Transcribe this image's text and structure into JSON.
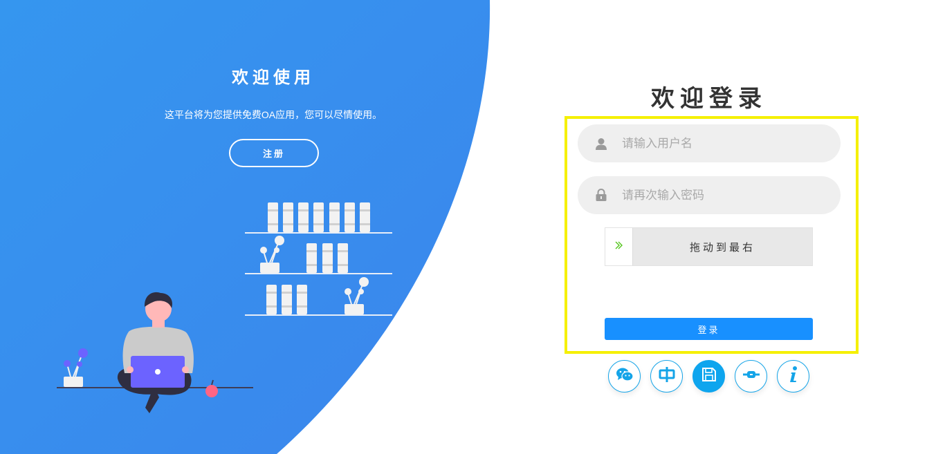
{
  "left": {
    "title": "欢迎使用",
    "subtitle": "这平台将为您提供免费OA应用，您可以尽情使用。",
    "register_label": "注册"
  },
  "login": {
    "title": "欢迎登录",
    "username_placeholder": "请输入用户名",
    "password_placeholder": "请再次输入密码",
    "slider_text": "拖动到最右",
    "submit_label": "登录"
  },
  "bottom_icons": [
    "wechat-icon",
    "chinese-language-icon",
    "save-icon",
    "plugin-icon",
    "info-icon"
  ],
  "colors": {
    "blue_bg": "#3a8ff0",
    "accent": "#1890ff",
    "icon_accent": "#14a4e8",
    "highlight_border": "#f5f000",
    "input_bg": "#efefef",
    "purple": "#6c63ff",
    "character_skin": "#ffb8b8"
  }
}
